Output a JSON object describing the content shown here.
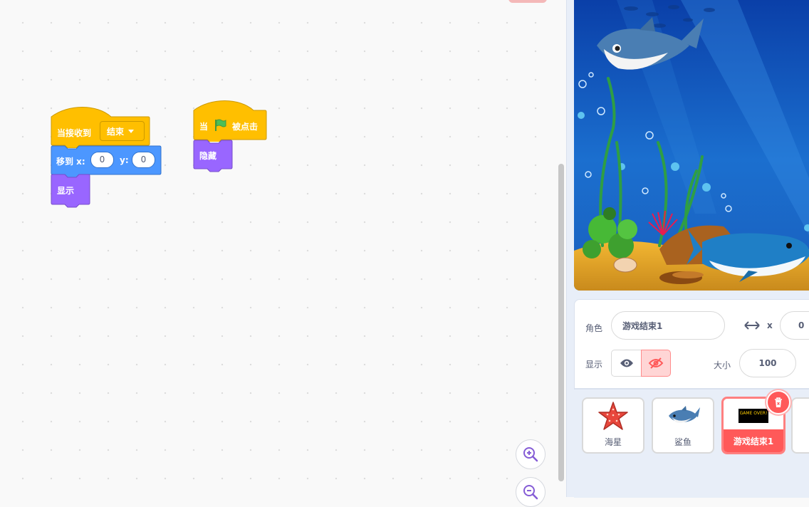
{
  "code_area": {
    "script1": {
      "hat_label": "当接收到",
      "message_value": "结束",
      "goto_label": "移到 x:",
      "goto_y_label": "y:",
      "x_value": "0",
      "y_value": "0",
      "show_label": "显示"
    },
    "script2": {
      "when_label": "当",
      "clicked_label": "被点击",
      "hide_label": "隐藏"
    }
  },
  "sprite_info": {
    "sprite_label": "角色",
    "sprite_name": "游戏结束1",
    "x_label": "x",
    "x_value": "0",
    "show_label": "显示",
    "size_label": "大小",
    "size_value": "100"
  },
  "sprites": [
    {
      "name": "海星",
      "icon": "starfish-icon"
    },
    {
      "name": "鲨鱼",
      "icon": "shark-icon"
    },
    {
      "name": "游戏结束1",
      "icon": "game-over-icon",
      "selected": true,
      "thumb_text": "GAME OVER!"
    }
  ],
  "colors": {
    "events": "#ffbf00",
    "motion": "#4c97ff",
    "looks": "#9966ff",
    "selected": "#ff5959"
  }
}
